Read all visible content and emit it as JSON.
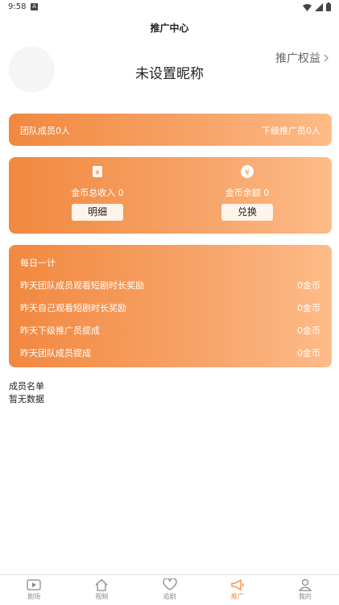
{
  "status": {
    "time": "9:58",
    "a_icon": "A",
    "icons": [
      "wifi-icon",
      "signal-icon",
      "battery-icon"
    ]
  },
  "header": {
    "title": "推广中心"
  },
  "profile": {
    "nickname": "未设置昵称",
    "benefit_link": "推广权益"
  },
  "team_card": {
    "team_members": "团队成员0人",
    "sub_promoters": "下级推广员0人"
  },
  "coin_card": {
    "total_income_label": "金币总收入 0",
    "detail_button": "明细",
    "balance_label": "金币余额 0",
    "exchange_button": "兑换",
    "icons": [
      "coin-box-icon",
      "yen-coin-icon"
    ]
  },
  "daily": {
    "header": "每日一计",
    "rows": [
      {
        "label": "昨天团队成员观看短剧时长奖励",
        "value": "0金币"
      },
      {
        "label": "昨天自己观看短剧时长奖励",
        "value": "0金币"
      },
      {
        "label": "昨天下级推广员提成",
        "value": "0金币"
      },
      {
        "label": "昨天团队成员提成",
        "value": "0金币"
      }
    ]
  },
  "members": {
    "title": "成员名单",
    "empty": "暂无数据"
  },
  "tabbar": {
    "tabs": [
      {
        "label": "剧场",
        "icon": "play-icon"
      },
      {
        "label": "视频",
        "icon": "home-icon"
      },
      {
        "label": "追剧",
        "icon": "heart-icon"
      },
      {
        "label": "推广",
        "icon": "megaphone-icon"
      },
      {
        "label": "我的",
        "icon": "user-icon"
      }
    ],
    "active_color": "#f08a3c"
  }
}
